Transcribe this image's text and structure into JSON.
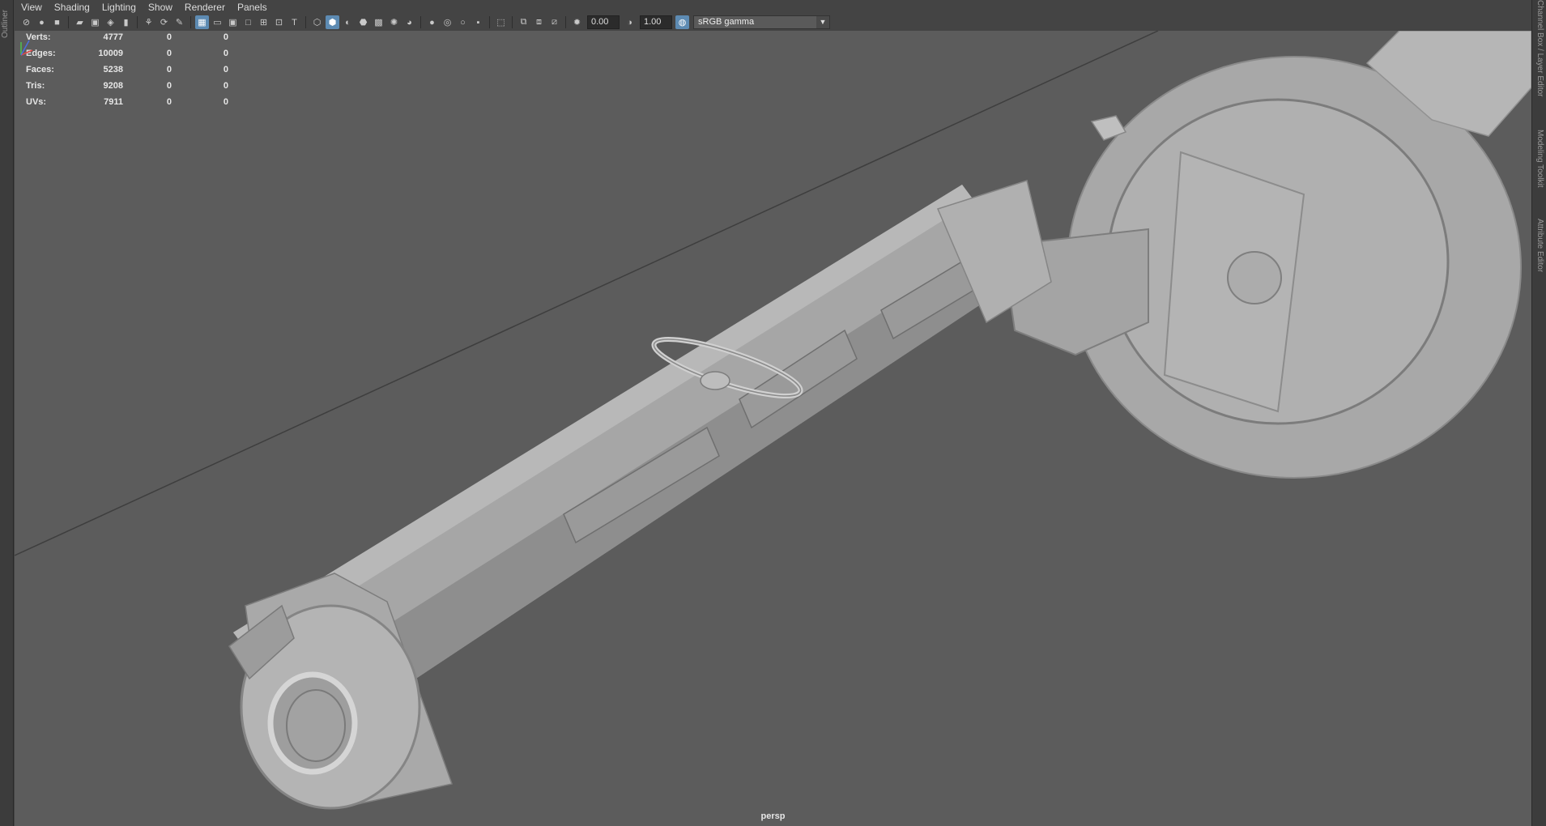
{
  "left_panel": {
    "tab_label": "Outliner"
  },
  "right_panel": {
    "tabs": [
      "Channel Box / Layer Editor",
      "Modeling Toolkit",
      "Attribute Editor"
    ]
  },
  "menubar": {
    "items": [
      "View",
      "Shading",
      "Lighting",
      "Show",
      "Renderer",
      "Panels"
    ]
  },
  "toolbar": {
    "exposure_value": "0.00",
    "gamma_value": "1.00",
    "color_space": "sRGB gamma"
  },
  "hud": {
    "rows": [
      {
        "label": "Verts:",
        "v1": "4777",
        "v2": "0",
        "v3": "0"
      },
      {
        "label": "Edges:",
        "v1": "10009",
        "v2": "0",
        "v3": "0"
      },
      {
        "label": "Faces:",
        "v1": "5238",
        "v2": "0",
        "v3": "0"
      },
      {
        "label": "Tris:",
        "v1": "9208",
        "v2": "0",
        "v3": "0"
      },
      {
        "label": "UVs:",
        "v1": "7911",
        "v2": "0",
        "v3": "0"
      }
    ]
  },
  "viewport": {
    "camera_label": "persp"
  },
  "colors": {
    "viewport_bg": "#5c5c5c",
    "panel_bg": "#444444",
    "active_accent": "#5d8bb3"
  }
}
